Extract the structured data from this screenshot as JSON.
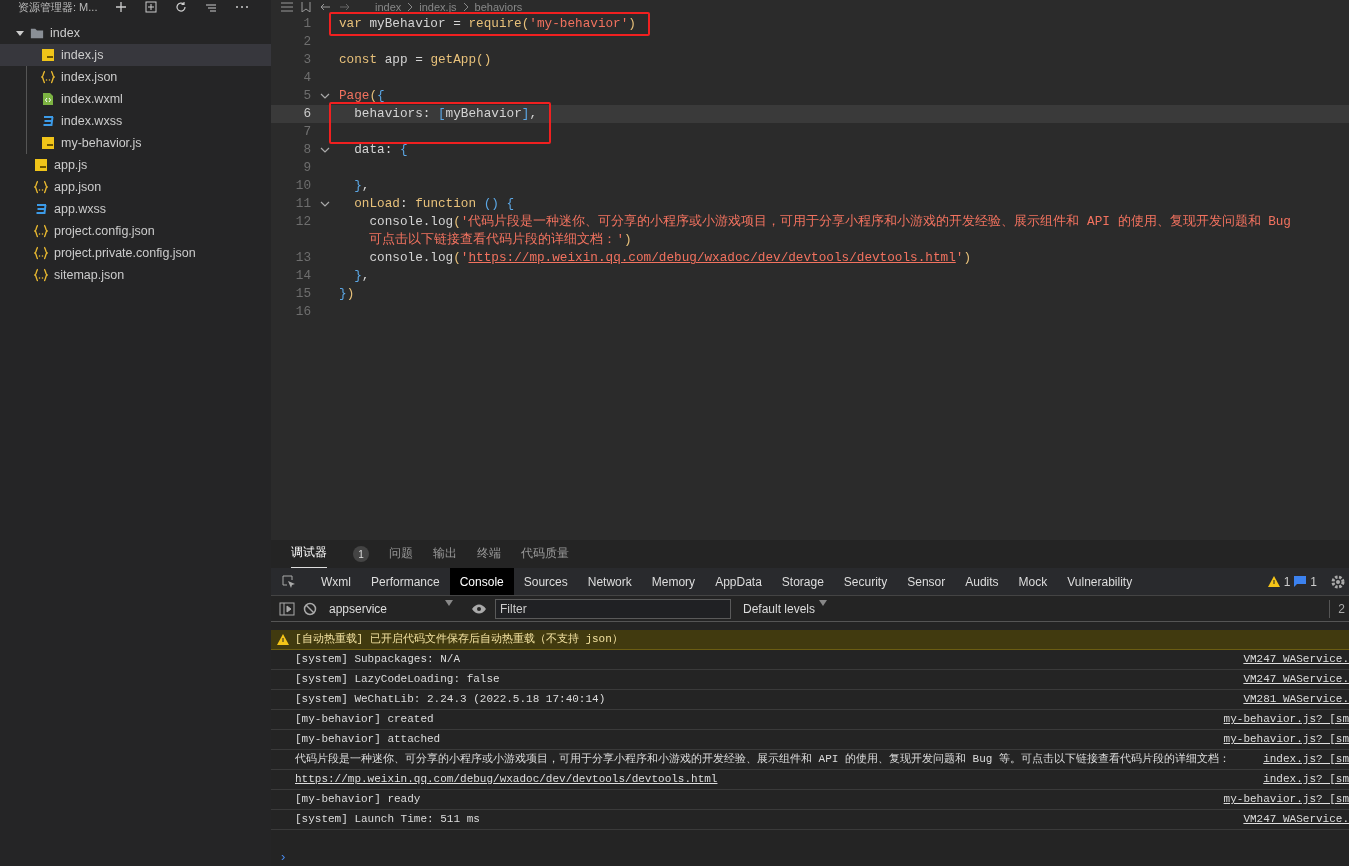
{
  "sidebar": {
    "title": "资源管理器: M...",
    "tree": [
      {
        "label": "index",
        "kind": "folder",
        "expanded": true,
        "selected": false,
        "children": [
          {
            "label": "index.js",
            "kind": "js",
            "selected": true
          },
          {
            "label": "index.json",
            "kind": "json",
            "selected": false
          },
          {
            "label": "index.wxml",
            "kind": "wxml",
            "selected": false
          },
          {
            "label": "index.wxss",
            "kind": "wxss",
            "selected": false
          },
          {
            "label": "my-behavior.js",
            "kind": "js",
            "selected": false
          }
        ]
      },
      {
        "label": "app.js",
        "kind": "js",
        "selected": false
      },
      {
        "label": "app.json",
        "kind": "json",
        "selected": false
      },
      {
        "label": "app.wxss",
        "kind": "wxss",
        "selected": false
      },
      {
        "label": "project.config.json",
        "kind": "json",
        "selected": false
      },
      {
        "label": "project.private.config.json",
        "kind": "json",
        "selected": false
      },
      {
        "label": "sitemap.json",
        "kind": "json",
        "selected": false
      }
    ]
  },
  "editor": {
    "breadcrumb": [
      "index",
      "index.js",
      "behaviors"
    ],
    "lines": [
      {
        "number": "1",
        "current": false,
        "fold": false,
        "boxed": true,
        "segments": [
          {
            "text": "var",
            "kind": "kw"
          },
          {
            "text": " myBehavior = ",
            "kind": "id"
          },
          {
            "text": "require",
            "kind": "fn"
          },
          {
            "text": "(",
            "kind": "paren"
          },
          {
            "text": "'my-behavior'",
            "kind": "str"
          },
          {
            "text": ")",
            "kind": "paren"
          }
        ]
      },
      {
        "number": "2",
        "current": false,
        "fold": false,
        "boxed": false
      },
      {
        "number": "3",
        "current": false,
        "fold": false,
        "boxed": false,
        "segments": [
          {
            "text": "const",
            "kind": "kw"
          },
          {
            "text": " app = ",
            "kind": "id"
          },
          {
            "text": "getApp",
            "kind": "fn"
          },
          {
            "text": "()",
            "kind": "paren"
          }
        ]
      },
      {
        "number": "4",
        "current": false,
        "fold": false,
        "boxed": false
      },
      {
        "number": "5",
        "current": false,
        "fold": true,
        "boxed": false,
        "segments": [
          {
            "text": "Page",
            "kind": "str"
          },
          {
            "text": "(",
            "kind": "paren"
          },
          {
            "text": "{",
            "kind": "brace"
          }
        ]
      },
      {
        "number": "6",
        "current": true,
        "fold": false,
        "boxed": true,
        "segments": [
          {
            "text": "  behaviors: ",
            "kind": "id"
          },
          {
            "text": "[",
            "kind": "brace"
          },
          {
            "text": "myBehavior",
            "kind": "id"
          },
          {
            "text": "]",
            "kind": "brace"
          },
          {
            "text": ",",
            "kind": "id"
          }
        ]
      },
      {
        "number": "7",
        "current": false,
        "fold": false,
        "boxed": true
      },
      {
        "number": "8",
        "current": false,
        "fold": true,
        "boxed": false,
        "segments": [
          {
            "text": "  data: ",
            "kind": "id"
          },
          {
            "text": "{",
            "kind": "brace"
          }
        ]
      },
      {
        "number": "9",
        "current": false,
        "fold": false,
        "boxed": false
      },
      {
        "number": "10",
        "current": false,
        "fold": false,
        "boxed": false,
        "segments": [
          {
            "text": "  }",
            "kind": "brace"
          },
          {
            "text": ",",
            "kind": "id"
          }
        ]
      },
      {
        "number": "11",
        "current": false,
        "fold": true,
        "boxed": false,
        "segments": [
          {
            "text": "  onLoad",
            "kind": "fn"
          },
          {
            "text": ": ",
            "kind": "id"
          },
          {
            "text": "function",
            "kind": "fn"
          },
          {
            "text": " () {",
            "kind": "brace"
          }
        ]
      },
      {
        "number": "12",
        "current": false,
        "fold": false,
        "boxed": false,
        "segments": [
          {
            "text": "    console.log",
            "kind": "id"
          },
          {
            "text": "(",
            "kind": "paren"
          },
          {
            "text": "'代码片段是一种迷你、可分享的小程序或小游戏项目，可用于分享小程序和小游戏的开发经验、展示组件和 API 的使用、复现开发问题和 Bug",
            "kind": "str"
          }
        ],
        "continuation": [
          {
            "text": "    可点击以下链接查看代码片段的详细文档：'",
            "kind": "str"
          },
          {
            "text": ")",
            "kind": "paren"
          }
        ]
      },
      {
        "number": "13",
        "current": false,
        "fold": false,
        "boxed": false,
        "segments": [
          {
            "text": "    console.log",
            "kind": "id"
          },
          {
            "text": "(",
            "kind": "paren"
          },
          {
            "text": "'",
            "kind": "str"
          },
          {
            "text": "https://mp.weixin.qq.com/debug/wxadoc/dev/devtools/devtools.html",
            "kind": "link"
          },
          {
            "text": "'",
            "kind": "str"
          },
          {
            "text": ")",
            "kind": "paren"
          }
        ]
      },
      {
        "number": "14",
        "current": false,
        "fold": false,
        "boxed": false,
        "segments": [
          {
            "text": "  }",
            "kind": "brace"
          },
          {
            "text": ",",
            "kind": "id"
          }
        ]
      },
      {
        "number": "15",
        "current": false,
        "fold": false,
        "boxed": false,
        "segments": [
          {
            "text": "}",
            "kind": "brace"
          },
          {
            "text": ")",
            "kind": "paren"
          }
        ]
      },
      {
        "number": "16",
        "current": false,
        "fold": false,
        "boxed": false
      }
    ]
  },
  "panel": {
    "tabs": [
      {
        "label": "调试器",
        "badge": "1",
        "selected": true
      },
      {
        "label": "问题",
        "selected": false
      },
      {
        "label": "输出",
        "selected": false
      },
      {
        "label": "终端",
        "selected": false
      },
      {
        "label": "代码质量",
        "selected": false
      }
    ],
    "devtools_tabs": [
      {
        "label": "Wxml",
        "selected": false
      },
      {
        "label": "Performance",
        "selected": false
      },
      {
        "label": "Console",
        "selected": true
      },
      {
        "label": "Sources",
        "selected": false
      },
      {
        "label": "Network",
        "selected": false
      },
      {
        "label": "Memory",
        "selected": false
      },
      {
        "label": "AppData",
        "selected": false
      },
      {
        "label": "Storage",
        "selected": false
      },
      {
        "label": "Security",
        "selected": false
      },
      {
        "label": "Sensor",
        "selected": false
      },
      {
        "label": "Audits",
        "selected": false
      },
      {
        "label": "Mock",
        "selected": false
      },
      {
        "label": "Vulnerability",
        "selected": false
      }
    ],
    "warning_count": "1",
    "info_count": "1",
    "toolbar": {
      "context": "appservice",
      "filter": {
        "placeholder": "Filter"
      },
      "levels": "Default levels",
      "hidden_count": "2"
    },
    "messages": [
      {
        "kind": "warning",
        "text": "[自动热重载] 已开启代码文件保存后自动热重载（不支持 json）"
      },
      {
        "kind": "log",
        "text": "[system] Subpackages: N/A",
        "source": "VM247 WAService."
      },
      {
        "kind": "log",
        "text": "[system] LazyCodeLoading: false",
        "source": "VM247 WAService."
      },
      {
        "kind": "log",
        "text": "[system] WeChatLib: 2.24.3 (2022.5.18 17:40:14)",
        "source": "VM281 WAService."
      },
      {
        "kind": "log",
        "text": "[my-behavior] created",
        "source": "my-behavior.js? [sm"
      },
      {
        "kind": "log",
        "text": "[my-behavior] attached",
        "source": "my-behavior.js? [sm"
      },
      {
        "kind": "log",
        "text": "代码片段是一种迷你、可分享的小程序或小游戏项目，可用于分享小程序和小游戏的开发经验、展示组件和 API 的使用、复现开发问题和 Bug 等。可点击以下链接查看代码片段的详细文档：",
        "source": "index.js? [sm"
      },
      {
        "kind": "link",
        "text": "https://mp.weixin.qq.com/debug/wxadoc/dev/devtools/devtools.html",
        "source": "index.js? [sm"
      },
      {
        "kind": "log",
        "text": "[my-behavior] ready",
        "source": "my-behavior.js? [sm"
      },
      {
        "kind": "log",
        "text": "[system] Launch Time: 511 ms",
        "source": "VM247 WAService."
      }
    ],
    "prompt": "›"
  }
}
